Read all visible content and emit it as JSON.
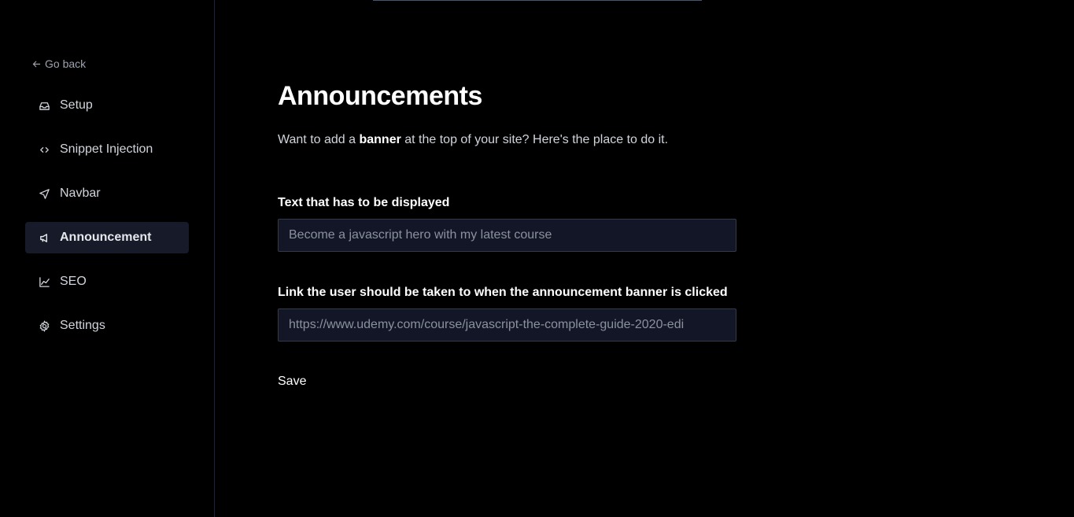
{
  "sidebar": {
    "go_back": "Go back",
    "items": [
      {
        "label": "Setup",
        "icon": "inbox-icon",
        "active": false
      },
      {
        "label": "Snippet Injection",
        "icon": "code-icon",
        "active": false
      },
      {
        "label": "Navbar",
        "icon": "send-icon",
        "active": false
      },
      {
        "label": "Announcement",
        "icon": "megaphone-icon",
        "active": true
      },
      {
        "label": "SEO",
        "icon": "chart-icon",
        "active": false
      },
      {
        "label": "Settings",
        "icon": "gear-icon",
        "active": false
      }
    ]
  },
  "main": {
    "title": "Announcements",
    "desc_before": "Want to add a ",
    "desc_bold": "banner",
    "desc_after": " at the top of your site? Here's the place to do it.",
    "text_label": "Text that has to be displayed",
    "text_placeholder": "Become a javascript hero with my latest course",
    "link_label": "Link the user should be taken to when the announcement banner is clicked",
    "link_placeholder": "https://www.udemy.com/course/javascript-the-complete-guide-2020-edi",
    "save_label": "Save"
  },
  "colors": {
    "background": "#000000",
    "active_item": "#161a29",
    "input_bg": "#121626",
    "input_border": "#343a4a"
  }
}
